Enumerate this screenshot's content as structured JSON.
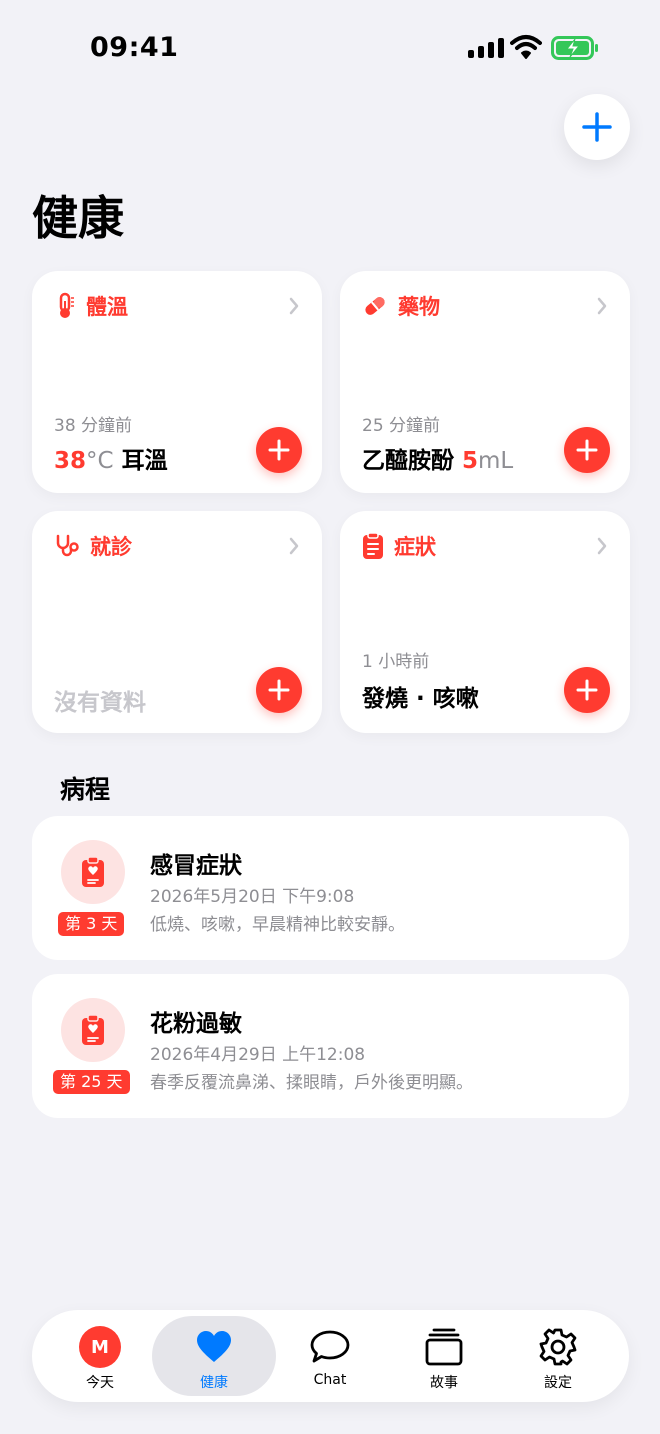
{
  "status": {
    "time": "09:41"
  },
  "header": {
    "title": "健康"
  },
  "cards": {
    "temperature": {
      "label": "體溫",
      "ago": "38 分鐘前",
      "value": "38",
      "unit": "°C",
      "site": "耳溫"
    },
    "medication": {
      "label": "藥物",
      "ago": "25 分鐘前",
      "name": "乙醯胺酚",
      "dose": "5",
      "unit": "mL"
    },
    "visit": {
      "label": "就診",
      "empty": "沒有資料"
    },
    "symptoms": {
      "label": "症狀",
      "ago": "1 小時前",
      "value": "發燒 · 咳嗽"
    }
  },
  "episodes": {
    "section_title": "病程",
    "items": [
      {
        "badge": "第 3 天",
        "title": "感冒症狀",
        "date": "2026年5月20日 下午9:08",
        "note": "低燒、咳嗽，早晨精神比較安靜。"
      },
      {
        "badge": "第 25 天",
        "title": "花粉過敏",
        "date": "2026年4月29日 上午12:08",
        "note": "春季反覆流鼻涕、揉眼睛，戶外後更明顯。"
      }
    ]
  },
  "tabbar": {
    "avatar_initial": "M",
    "items": [
      {
        "label": "今天",
        "icon": "avatar"
      },
      {
        "label": "健康",
        "icon": "heart-icon"
      },
      {
        "label": "Chat",
        "icon": "chat-bubble-icon"
      },
      {
        "label": "故事",
        "icon": "stack-icon"
      },
      {
        "label": "設定",
        "icon": "gear-icon"
      }
    ]
  },
  "colors": {
    "accent_red": "#ff3b30",
    "accent_blue": "#007aff",
    "background": "#f2f2f7"
  }
}
